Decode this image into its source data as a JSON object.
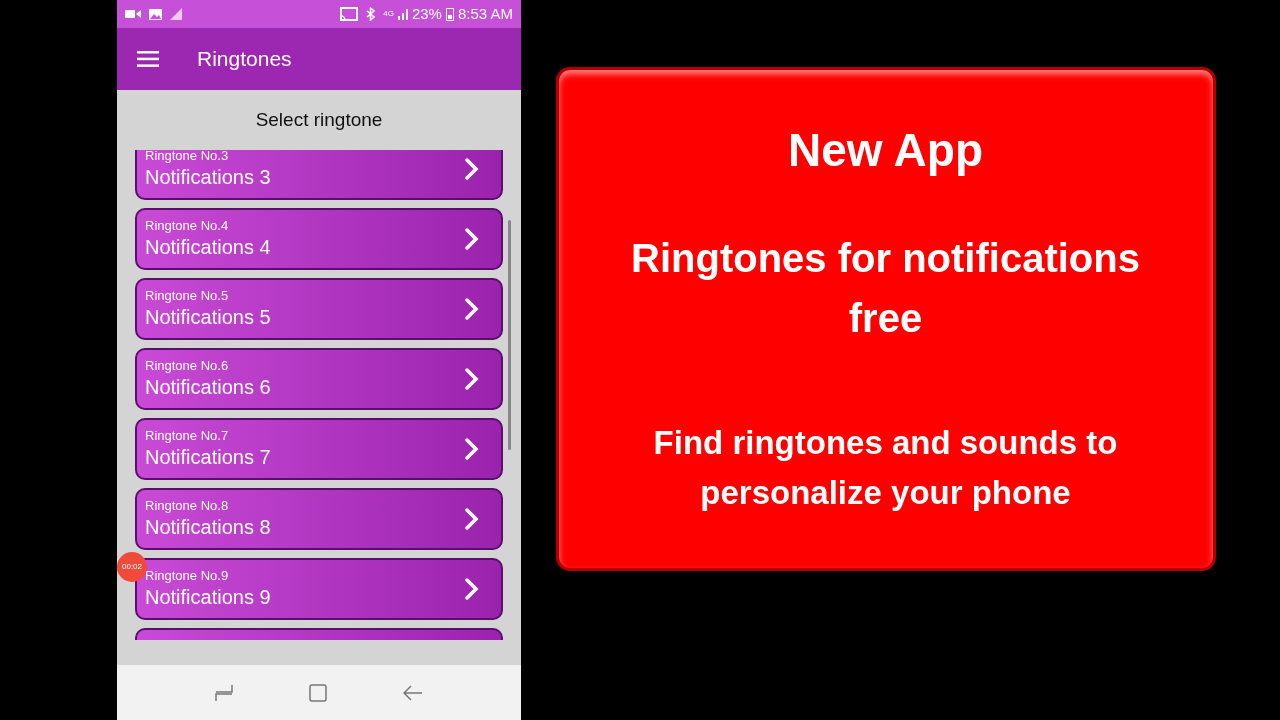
{
  "status_bar": {
    "battery": "23%",
    "time": "8:53 AM",
    "network": "4G"
  },
  "app_bar": {
    "title": "Ringtones"
  },
  "header": "Select ringtone",
  "ringtones": [
    {
      "number": "Ringtone No.3",
      "name": "Notifications 3"
    },
    {
      "number": "Ringtone No.4",
      "name": "Notifications 4"
    },
    {
      "number": "Ringtone No.5",
      "name": "Notifications 5"
    },
    {
      "number": "Ringtone No.6",
      "name": "Notifications 6"
    },
    {
      "number": "Ringtone No.7",
      "name": "Notifications 7"
    },
    {
      "number": "Ringtone No.8",
      "name": "Notifications 8"
    },
    {
      "number": "Ringtone No.9",
      "name": "Notifications 9"
    }
  ],
  "more_below": true,
  "recording_badge": "00:02",
  "promo": {
    "title": "New App",
    "headline": "Ringtones for notifications free",
    "tagline": "Find ringtones and sounds to personalize your phone"
  }
}
